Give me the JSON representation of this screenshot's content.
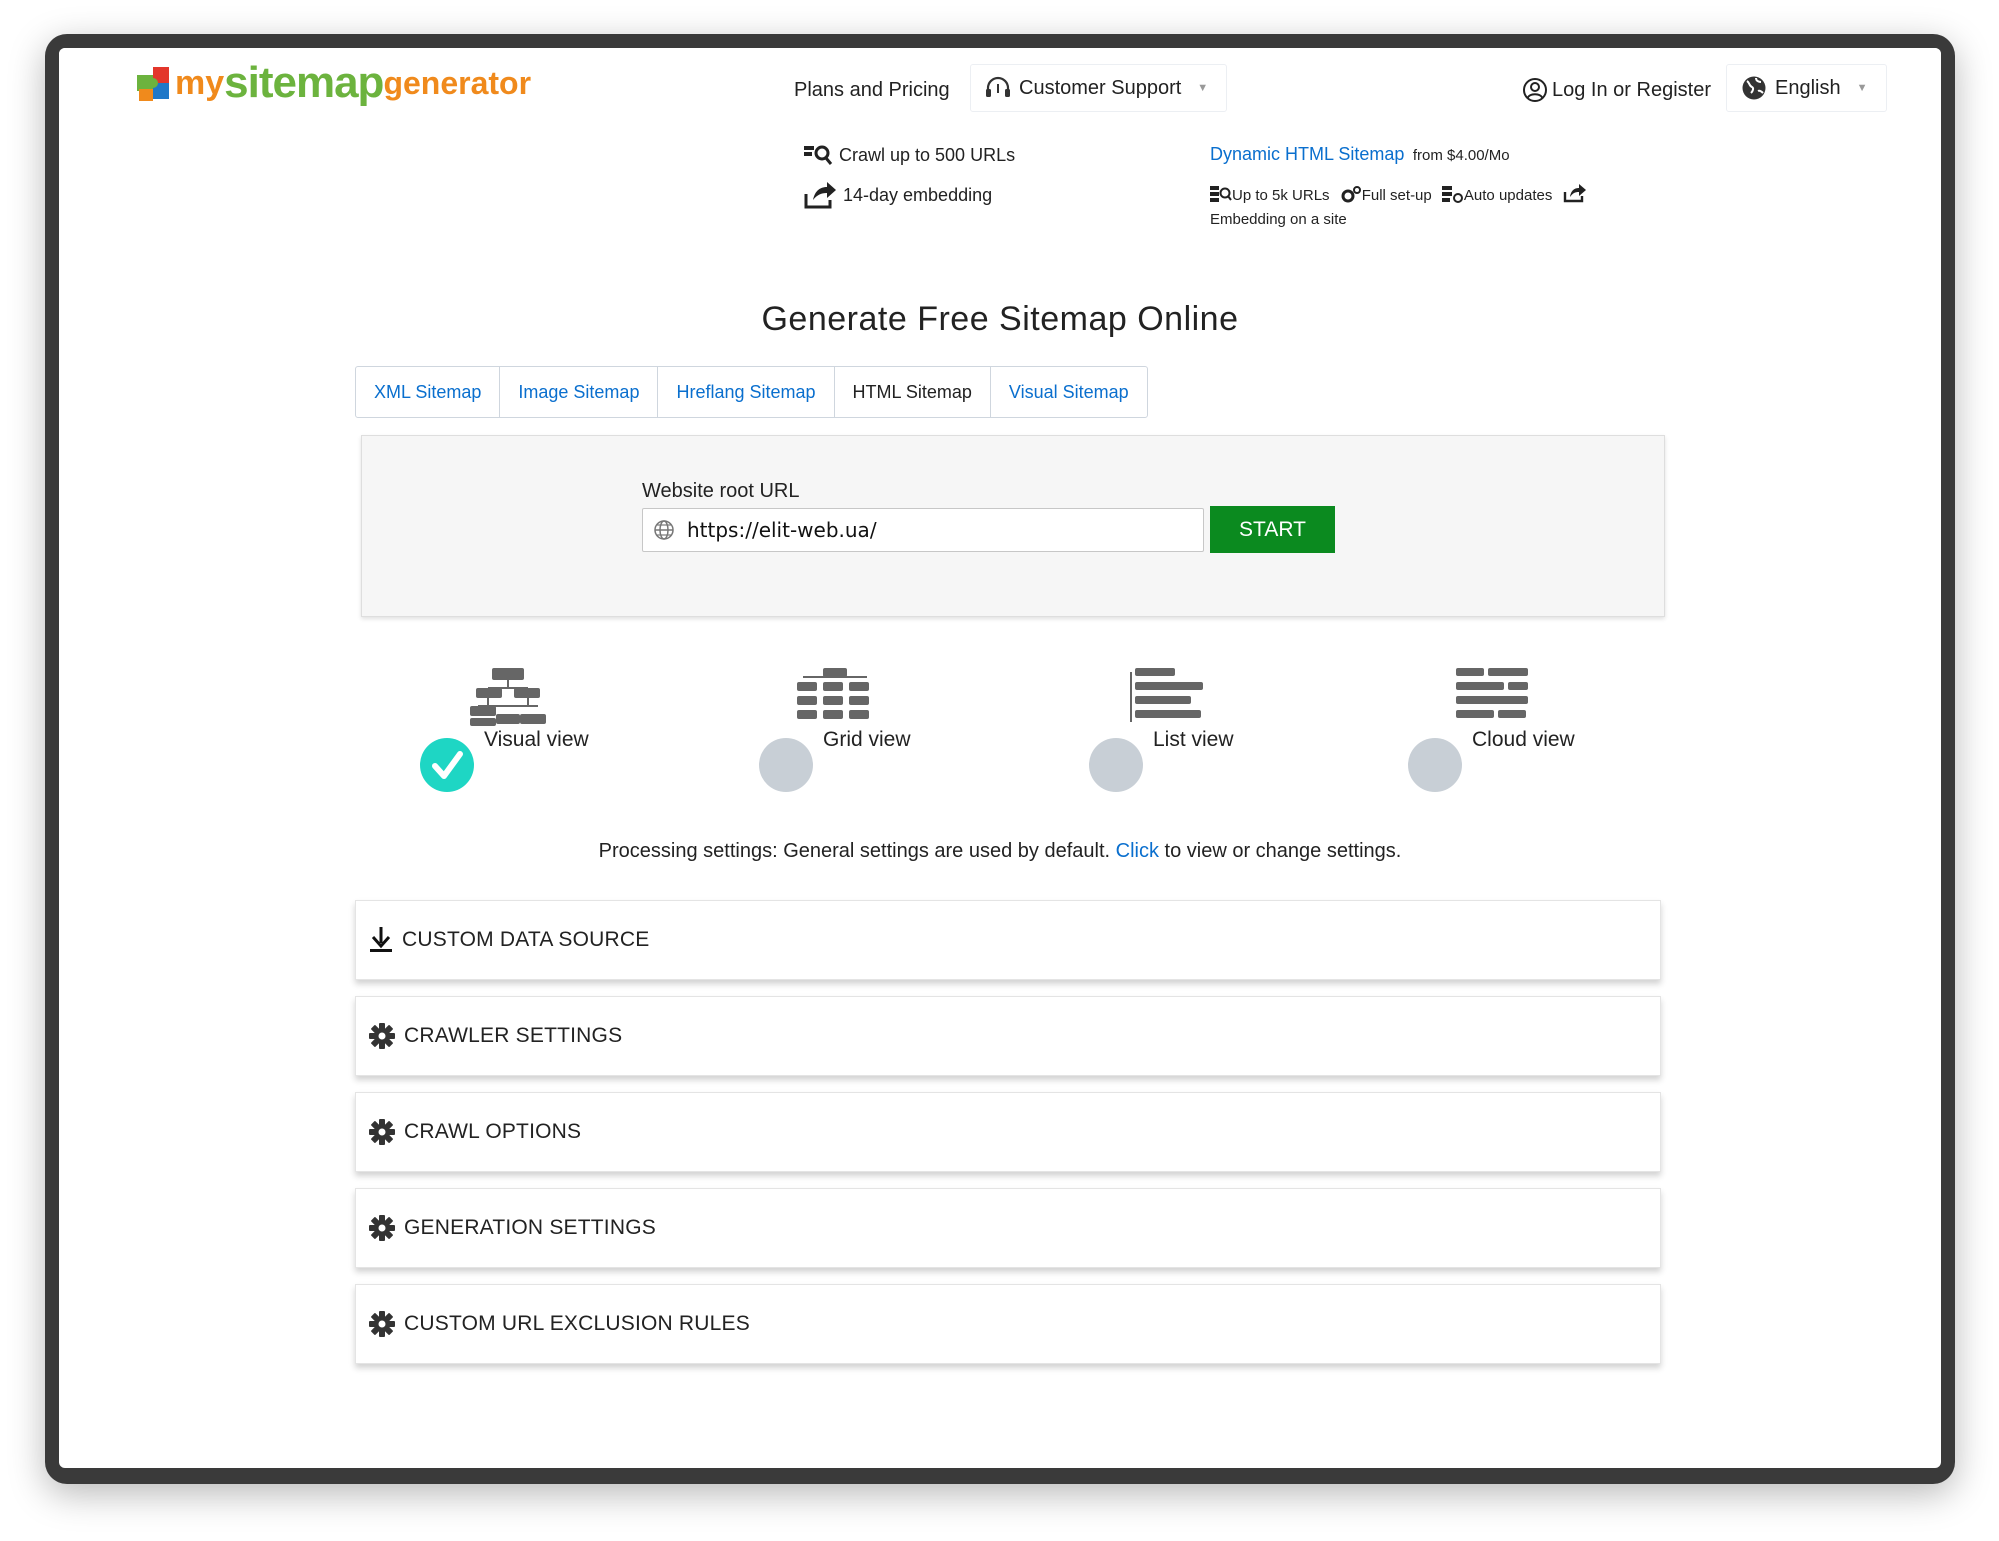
{
  "header": {
    "logo": {
      "my": "my",
      "site": "sitemap",
      "gen": "generator"
    },
    "plans_label": "Plans and Pricing",
    "support_label": "Customer Support",
    "login_label": "Log In or Register",
    "language_label": "English"
  },
  "hero": {
    "left_features": [
      "Crawl up to 500 URLs",
      "14-day embedding"
    ],
    "plan_link": "Dynamic HTML Sitemap",
    "plan_price": "from $4.00/Mo",
    "plan_features": [
      "Up to 5k URLs",
      "Full set-up",
      "Auto updates",
      "Embedding on a site"
    ]
  },
  "main": {
    "title": "Generate Free Sitemap Online",
    "tabs": [
      {
        "label": "XML Sitemap"
      },
      {
        "label": "Image Sitemap"
      },
      {
        "label": "Hreflang Sitemap"
      },
      {
        "label": "HTML Sitemap"
      },
      {
        "label": "Visual Sitemap"
      }
    ],
    "url_label": "Website root URL",
    "url_value": "https://elit-web.ua/",
    "start_label": "START",
    "views": [
      {
        "label": "Visual view",
        "selected": true
      },
      {
        "label": "Grid view",
        "selected": false
      },
      {
        "label": "List view",
        "selected": false
      },
      {
        "label": "Cloud view",
        "selected": false
      }
    ],
    "processing": {
      "before": "Processing settings: General settings are used by default.",
      "link": "Click",
      "after": "to view or change settings."
    },
    "sections": [
      {
        "title": "CUSTOM DATA SOURCE",
        "icon": "download-icon"
      },
      {
        "title": "CRAWLER SETTINGS",
        "icon": "gear-icon"
      },
      {
        "title": "CRAWL OPTIONS",
        "icon": "gear-icon"
      },
      {
        "title": "GENERATION SETTINGS",
        "icon": "gear-icon"
      },
      {
        "title": "CUSTOM URL EXCLUSION RULES",
        "icon": "gear-icon"
      }
    ]
  },
  "colors": {
    "link": "#0a6fce",
    "start_button": "#0b8a1f",
    "radio_selected": "#1ed6c4",
    "radio_unselected": "#c8cfd6"
  }
}
